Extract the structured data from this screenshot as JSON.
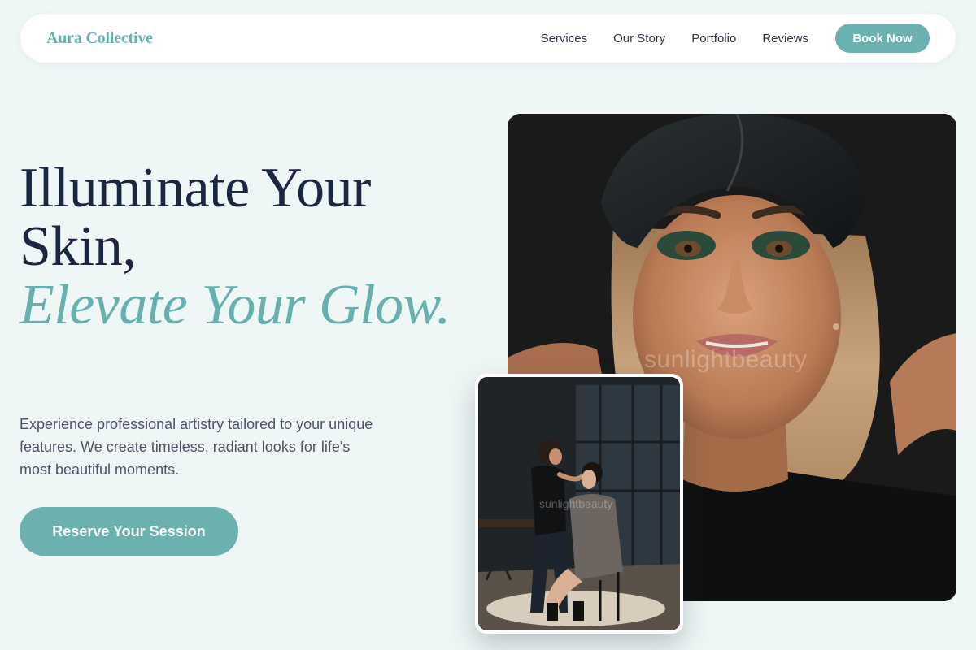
{
  "nav": {
    "brand": "Aura Collective",
    "links": [
      "Services",
      "Our Story",
      "Portfolio",
      "Reviews"
    ],
    "book_label": "Book Now"
  },
  "hero": {
    "title_line1": "Illuminate Your Skin,",
    "title_accent": "Elevate Your Glow.",
    "description": "Experience professional artistry tailored to your unique features. We create timeless, radiant looks for life's most beautiful moments.",
    "cta_label": "Reserve Your Session"
  },
  "images": {
    "main_watermark": "sunlightbeauty",
    "inset_watermark": "sunlightbeauty"
  },
  "colors": {
    "accent": "#6ab1b0",
    "background": "#eff7f6",
    "heading": "#1b2740"
  }
}
